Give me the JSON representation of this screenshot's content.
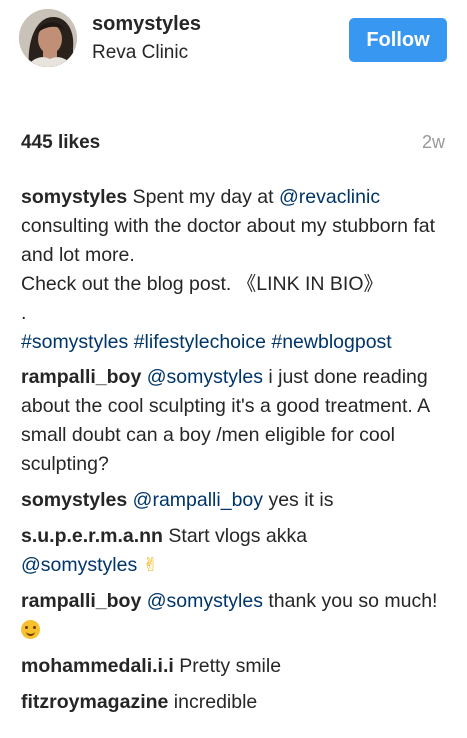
{
  "header": {
    "username": "somystyles",
    "location": "Reva Clinic",
    "follow_label": "Follow",
    "avatar_icon": "profile-photo"
  },
  "stats": {
    "likes": "445 likes",
    "time_ago": "2w"
  },
  "caption": {
    "username": "somystyles",
    "text_before_mention": "Spent my day at",
    "mention": "@revaclinic",
    "text_after_mention": "consulting with the doctor about my stubborn fat and lot more.",
    "line2": "Check out the blog post. 《LINK IN BIO》",
    "line3": ".",
    "hashtags": [
      "#somystyles",
      "#lifestylechoice",
      "#newblogpost"
    ]
  },
  "comments": [
    {
      "username": "rampalli_boy",
      "mention": "@somystyles",
      "text": "i just done reading about the cool sculpting it's a good treatment. A small doubt can a boy /men eligible for cool sculpting?"
    },
    {
      "username": "somystyles",
      "mention": "@rampalli_boy",
      "text": "yes it is"
    },
    {
      "username": "s.u.p.e.r.m.a.nn",
      "text": "Start vlogs akka",
      "mention_after": "@somystyles",
      "emoji": "victory-hand-emoji"
    },
    {
      "username": "rampalli_boy",
      "mention": "@somystyles",
      "text": "thank you so much!",
      "emoji": "smiling-face-emoji"
    },
    {
      "username": "mohammedali.i.i",
      "text": "Pretty smile"
    },
    {
      "username": "fitzroymagazine",
      "text": "incredible"
    }
  ],
  "colors": {
    "follow_button": "#3897f0",
    "link": "#003569",
    "text": "#262626",
    "muted": "#999999"
  }
}
